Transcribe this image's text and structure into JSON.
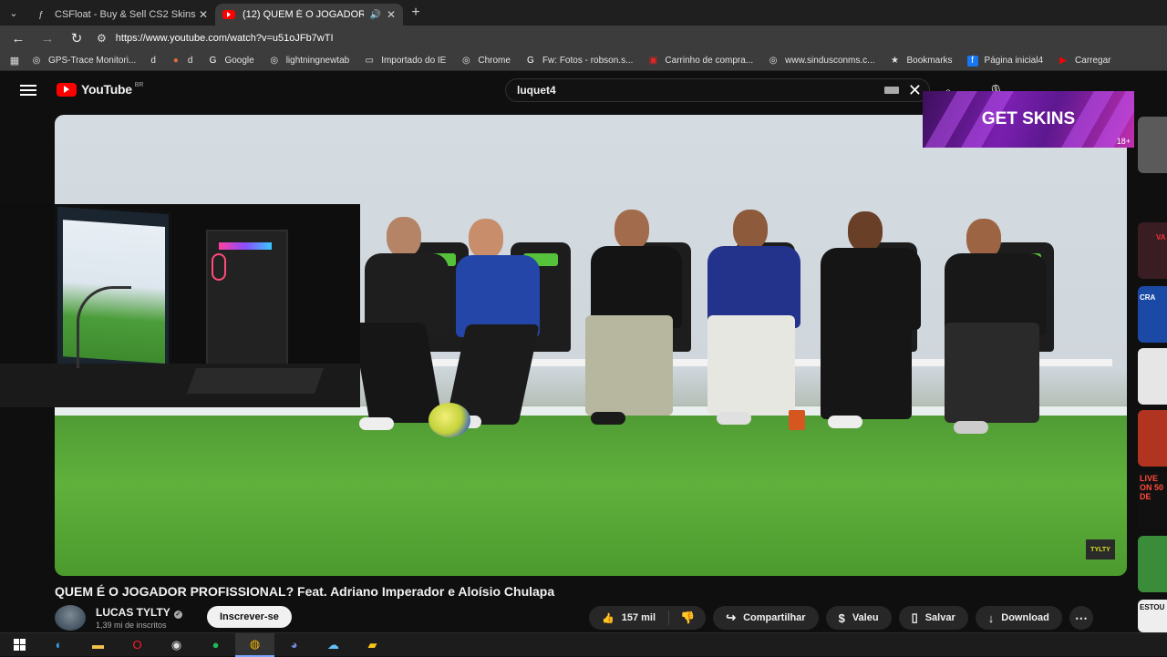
{
  "browser": {
    "tabs": [
      {
        "title": "CSFloat - Buy & Sell CS2 Skins o",
        "favicon": "csfloat-icon",
        "active": false
      },
      {
        "title": "(12) QUEM É O JOGADOR P",
        "favicon": "youtube-icon",
        "active": true
      }
    ],
    "url": "https://www.youtube.com/watch?v=u51oJFb7wTI",
    "bookmarks": [
      {
        "label": "GPS-Trace Monitori...",
        "icon": "globe-icon"
      },
      {
        "label": "d",
        "icon": "blank-icon"
      },
      {
        "label": "d",
        "icon": "bookmark-icon"
      },
      {
        "label": "Google",
        "icon": "google-icon"
      },
      {
        "label": "lightningnewtab",
        "icon": "globe-icon"
      },
      {
        "label": "Importado do IE",
        "icon": "folder-icon"
      },
      {
        "label": "Chrome",
        "icon": "globe-icon"
      },
      {
        "label": "Fw: Fotos - robson.s...",
        "icon": "google-icon"
      },
      {
        "label": "Carrinho de compra...",
        "icon": "store-icon"
      },
      {
        "label": "www.sindusconms.c...",
        "icon": "globe-icon"
      },
      {
        "label": "Bookmarks",
        "icon": "star-icon"
      },
      {
        "label": "Página inicial4",
        "icon": "facebook-icon"
      },
      {
        "label": "Carregar",
        "icon": "youtube-icon"
      }
    ]
  },
  "youtube": {
    "logo_text": "YouTube",
    "region": "BR",
    "search_query": "luquet4",
    "ad_text": "GET SKINS",
    "ad_age": "18+",
    "watermark": "TYLTY",
    "video_title": "QUEM É O JOGADOR PROFISSIONAL? Feat. Adriano Imperador e Aloísio Chulapa",
    "channel_name": "LUCAS TYLTY",
    "subscribers": "1,39 mi de inscritos",
    "subscribe_label": "Inscrever-se",
    "likes": "157 mil",
    "share_label": "Compartilhar",
    "thanks_label": "Valeu",
    "save_label": "Salvar",
    "download_label": "Download",
    "sidebar_thumbs": [
      "",
      "VA",
      "CRA",
      "",
      "",
      "LIVE ON 50 DE",
      "",
      "ESTOU"
    ]
  },
  "taskbar": {
    "apps": [
      "windows-icon",
      "edge-icon",
      "file-explorer-icon",
      "opera-icon",
      "obs-icon",
      "spotify-icon",
      "chrome-icon",
      "discord-icon",
      "steam-icon",
      "app-icon"
    ]
  }
}
